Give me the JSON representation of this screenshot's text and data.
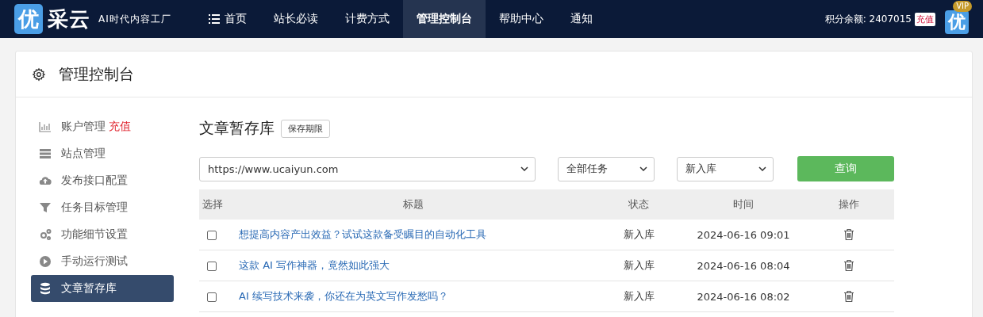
{
  "brand": {
    "logo_char": "优",
    "name": "采云",
    "slogan": "AI时代内容工厂"
  },
  "nav": [
    {
      "label": "首页",
      "selected": false
    },
    {
      "label": "站长必读",
      "selected": false
    },
    {
      "label": "计费方式",
      "selected": false
    },
    {
      "label": "管理控制台",
      "selected": true
    },
    {
      "label": "帮助中心",
      "selected": false
    },
    {
      "label": "通知",
      "selected": false
    }
  ],
  "account": {
    "balance": "积分余额: 2407015",
    "recharge": "充值",
    "avatar_char": "优",
    "vip": "VIP"
  },
  "panel_title": "管理控制台",
  "sidebar": [
    {
      "label": "账户管理",
      "badge": "充值",
      "selected": false
    },
    {
      "label": "站点管理",
      "selected": false
    },
    {
      "label": "发布接口配置",
      "selected": false
    },
    {
      "label": "任务目标管理",
      "selected": false
    },
    {
      "label": "功能细节设置",
      "selected": false
    },
    {
      "label": "手动运行测试",
      "selected": false
    },
    {
      "label": "文章暂存库",
      "selected": true
    }
  ],
  "content": {
    "title": "文章暂存库",
    "title_button": "保存期限",
    "filters": [
      {
        "value": "https://www.ucaiyun.com",
        "kind": "wide"
      },
      {
        "value": "全部任务",
        "kind": "narrow"
      },
      {
        "value": "新入库",
        "kind": "narrow"
      }
    ],
    "query_button": "查询",
    "table": {
      "columns": [
        "选择",
        "标题",
        "状态",
        "时间",
        "操作"
      ],
      "rows": [
        {
          "checked": false,
          "title": "想提高内容产出效益？试试这款备受瞩目的自动化工具",
          "status": "新入库",
          "time": "2024-06-16 09:01"
        },
        {
          "checked": false,
          "title": "这款 AI 写作神器，竟然如此强大",
          "status": "新入库",
          "time": "2024-06-16 08:04"
        },
        {
          "checked": false,
          "title": "AI 续写技术来袭，你还在为英文写作发愁吗？",
          "status": "新入库",
          "time": "2024-06-16 08:02"
        }
      ]
    }
  }
}
